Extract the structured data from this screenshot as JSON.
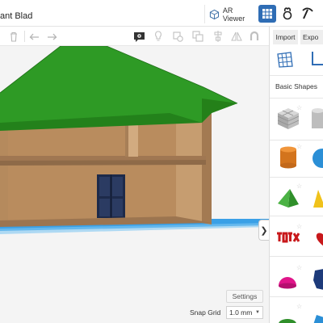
{
  "header": {
    "design_title": "ant Blad",
    "ar_viewer_label": "AR Viewer"
  },
  "panel": {
    "import_label": "Import",
    "export_label": "Expo",
    "section_label": "Basic Shapes"
  },
  "viewport": {
    "collapse_glyph": "❯",
    "settings_label": "Settings",
    "snap_grid_label": "Snap Grid",
    "snap_grid_value": "1.0 mm"
  },
  "colors": {
    "roof": "#2e9a25",
    "wall": "#c59a6c",
    "door": "#1d2a4a",
    "ground": "#3aa0e6",
    "accent": "#2f6db5"
  }
}
